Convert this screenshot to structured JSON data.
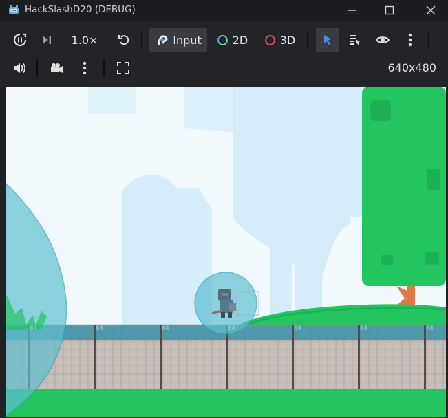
{
  "window": {
    "title": "HackSlashD20 (DEBUG)"
  },
  "toolbar": {
    "speed_label": "1.0×",
    "input_label": "Input",
    "mode_2d_label": "2D",
    "mode_3d_label": "3D",
    "resolution": "640x480"
  },
  "colors": {
    "accent_blue": "#4c8bf5",
    "mode_2d_ring": "#6fd0a8",
    "mode_3d_ring": "#e04c5c",
    "grass": "#22c55e",
    "water_shape": "#5fbfd0"
  },
  "viewport": {
    "tile_labels": [
      "64",
      "64",
      "64",
      "64",
      "64",
      "64",
      "64"
    ]
  }
}
